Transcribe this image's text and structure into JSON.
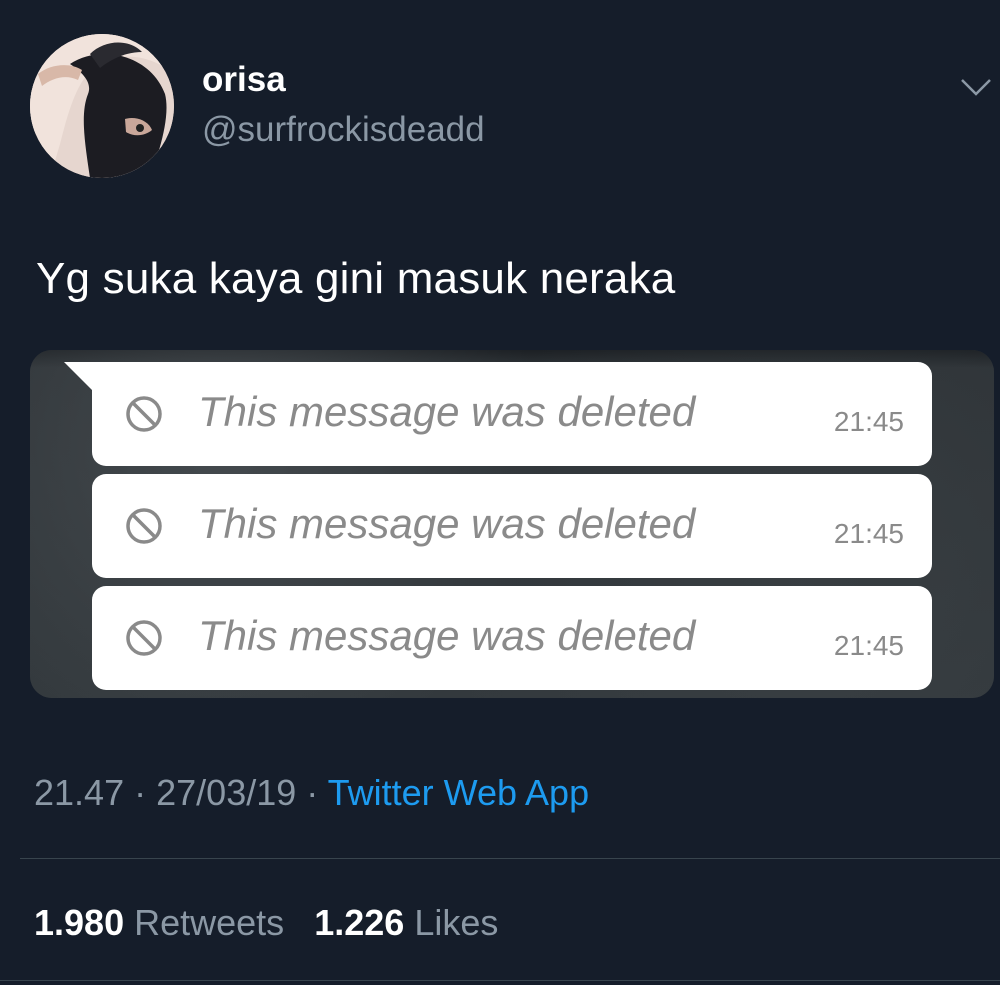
{
  "author": {
    "display_name": "orisa",
    "handle": "@surfrockisdeadd",
    "avatar_icon": "profile-photo",
    "menu_icon": "chevron-down-icon"
  },
  "tweet": {
    "text": "Yg suka kaya gini masuk neraka",
    "timestamp": "21.47",
    "date": "27/03/19",
    "separator": "·",
    "source": "Twitter Web App"
  },
  "media": {
    "messages": [
      {
        "icon": "ban-icon",
        "text": "This message was deleted",
        "time": "21:45"
      },
      {
        "icon": "ban-icon",
        "text": "This message was deleted",
        "time": "21:45"
      },
      {
        "icon": "ban-icon",
        "text": "This message was deleted",
        "time": "21:45"
      }
    ]
  },
  "stats": {
    "retweets_count": "1.980",
    "retweets_label": "Retweets",
    "likes_count": "1.226",
    "likes_label": "Likes"
  },
  "colors": {
    "background": "#151d2a",
    "secondary_text": "#8b98a5",
    "link": "#1d9bf0",
    "bubble": "#ffffff",
    "deleted_text": "#8a8a8a"
  }
}
